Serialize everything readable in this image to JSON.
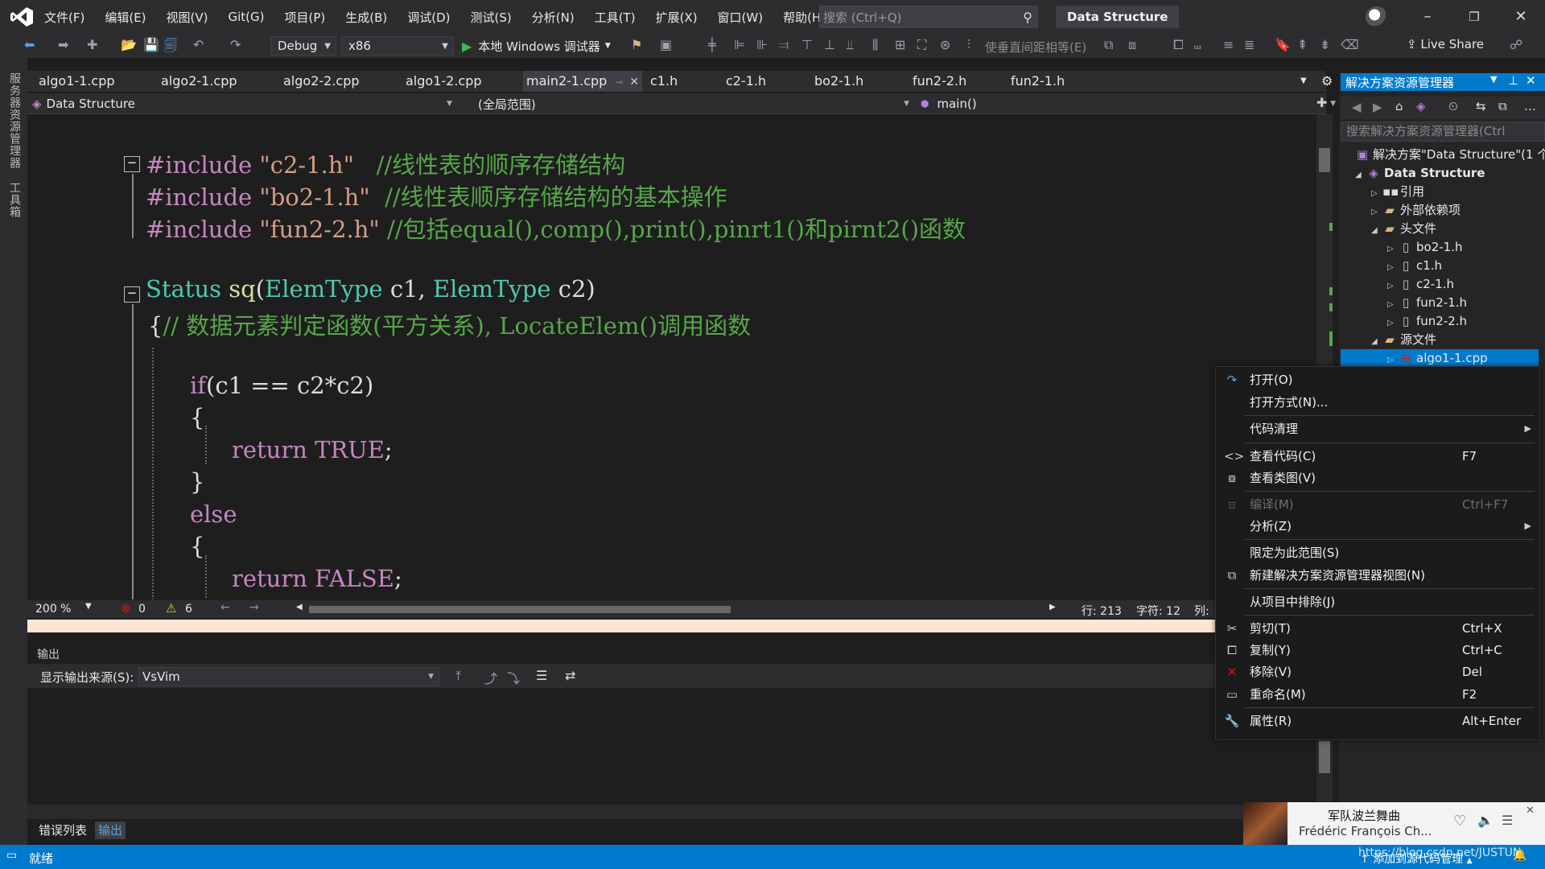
{
  "window": {
    "menu": [
      "文件(F)",
      "编辑(E)",
      "视图(V)",
      "Git(G)",
      "项目(P)",
      "生成(B)",
      "调试(D)",
      "测试(S)",
      "分析(N)",
      "工具(T)",
      "扩展(X)",
      "窗口(W)",
      "帮助(H)"
    ],
    "search_placeholder": "搜索 (Ctrl+Q)",
    "solution_title": "Data Structure"
  },
  "toolbar": {
    "config": "Debug",
    "platform": "x86",
    "debugger": "本地 Windows 调试器",
    "align_label": "使垂直间距相等(E)",
    "live_share": "Live Share"
  },
  "left_strip": {
    "server_explorer": "服务器资源管理器",
    "toolbox": "工具箱"
  },
  "tabs": [
    {
      "label": "algo1-1.cpp"
    },
    {
      "label": "algo2-1.cpp"
    },
    {
      "label": "algo2-2.cpp"
    },
    {
      "label": "algo1-2.cpp"
    },
    {
      "label": "main2-1.cpp"
    },
    {
      "label": "c1.h"
    },
    {
      "label": "c2-1.h"
    },
    {
      "label": "bo2-1.h"
    },
    {
      "label": "fun2-2.h"
    },
    {
      "label": "fun2-1.h"
    }
  ],
  "navbar": {
    "project": "Data Structure",
    "scope": "(全局范围)",
    "member": "main()"
  },
  "code": {
    "l1_kw": "#include",
    "l1_str": "\"c2-1.h\"",
    "l1_cmt": "//线性表的顺序存储结构",
    "l2_kw": "#include",
    "l2_str": "\"bo2-1.h\"",
    "l2_cmt": "//线性表顺序存储结构的基本操作",
    "l3_kw": "#include",
    "l3_str": "\"fun2-2.h\"",
    "l3_cmt": "//包括equal(),comp(),print(),pinrt1()和pirnt2()函数",
    "l4_type": "Status",
    "l4_fn": "sq",
    "l4_p1t": "ElemType",
    "l4_p1": "c1,",
    "l4_p2t": "ElemType",
    "l4_p2": "c2)",
    "l5_brace": "{",
    "l5_cmt": "// 数据元素判定函数(平方关系), LocateElem()调用函数",
    "l6_kw": "if",
    "l6_rest": "(c1 == c2*c2)",
    "l7": "{",
    "l8_kw": "return",
    "l8_val": "TRUE",
    "l8_end": ";",
    "l9": "}",
    "l10_kw": "else",
    "l11": "{",
    "l12_kw": "return",
    "l12_val": "FALSE",
    "l12_end": ";"
  },
  "editor_status": {
    "zoom": "200 %",
    "errors": "0",
    "warnings": "6",
    "line": "行: 213",
    "char": "字符: 12",
    "col": "列:"
  },
  "output": {
    "title": "输出",
    "source_label": "显示输出来源(S):",
    "source_value": "VsVim"
  },
  "bottom_tabs": {
    "errors": "错误列表",
    "output": "输出"
  },
  "statusbar": {
    "ready": "就绪",
    "add_source": "添加到源代码管理",
    "watermark": "https://blog.csdn.net/JUSTUN"
  },
  "solution_explorer": {
    "title": "解决方案资源管理器",
    "search_placeholder": "搜索解决方案资源管理器(Ctrl",
    "items": [
      {
        "label": "解决方案\"Data Structure\"(1 个"
      },
      {
        "label": "Data Structure"
      },
      {
        "label": "引用"
      },
      {
        "label": "外部依赖项"
      },
      {
        "label": "头文件"
      },
      {
        "label": "bo2-1.h"
      },
      {
        "label": "c1.h"
      },
      {
        "label": "c2-1.h"
      },
      {
        "label": "fun2-1.h"
      },
      {
        "label": "fun2-2.h"
      },
      {
        "label": "源文件"
      },
      {
        "label": "algo1-1.cpp"
      }
    ]
  },
  "context_menu": [
    {
      "label": "打开(O)",
      "key": "",
      "icon": "open-arrow-icon"
    },
    {
      "label": "打开方式(N)...",
      "key": ""
    },
    {
      "label": "代码清理",
      "key": "",
      "submenu": true
    },
    {
      "label": "查看代码(C)",
      "key": "F7",
      "icon": "code-icon"
    },
    {
      "label": "查看类图(V)",
      "key": "",
      "icon": "class-diagram-icon"
    },
    {
      "label": "编译(M)",
      "key": "Ctrl+F7",
      "disabled": true
    },
    {
      "label": "分析(Z)",
      "key": "",
      "submenu": true
    },
    {
      "label": "限定为此范围(S)",
      "key": ""
    },
    {
      "label": "新建解决方案资源管理器视图(N)",
      "key": "",
      "icon": "new-view-icon"
    },
    {
      "label": "从项目中排除(J)",
      "key": ""
    },
    {
      "label": "剪切(T)",
      "key": "Ctrl+X",
      "icon": "scissors-icon"
    },
    {
      "label": "复制(Y)",
      "key": "Ctrl+C",
      "icon": "copy-icon"
    },
    {
      "label": "移除(V)",
      "key": "Del",
      "icon": "remove-x-icon"
    },
    {
      "label": "重命名(M)",
      "key": "F2",
      "icon": "rename-icon"
    },
    {
      "label": "属性(R)",
      "key": "Alt+Enter",
      "icon": "wrench-icon"
    }
  ],
  "media": {
    "title": "军队波兰舞曲",
    "artist": "Frédéric François Ch..."
  },
  "colors": {
    "accent": "#007acc",
    "keyword": "#c586c0",
    "comment": "#57a64a",
    "type": "#4ec9b0",
    "string": "#d69d85"
  }
}
